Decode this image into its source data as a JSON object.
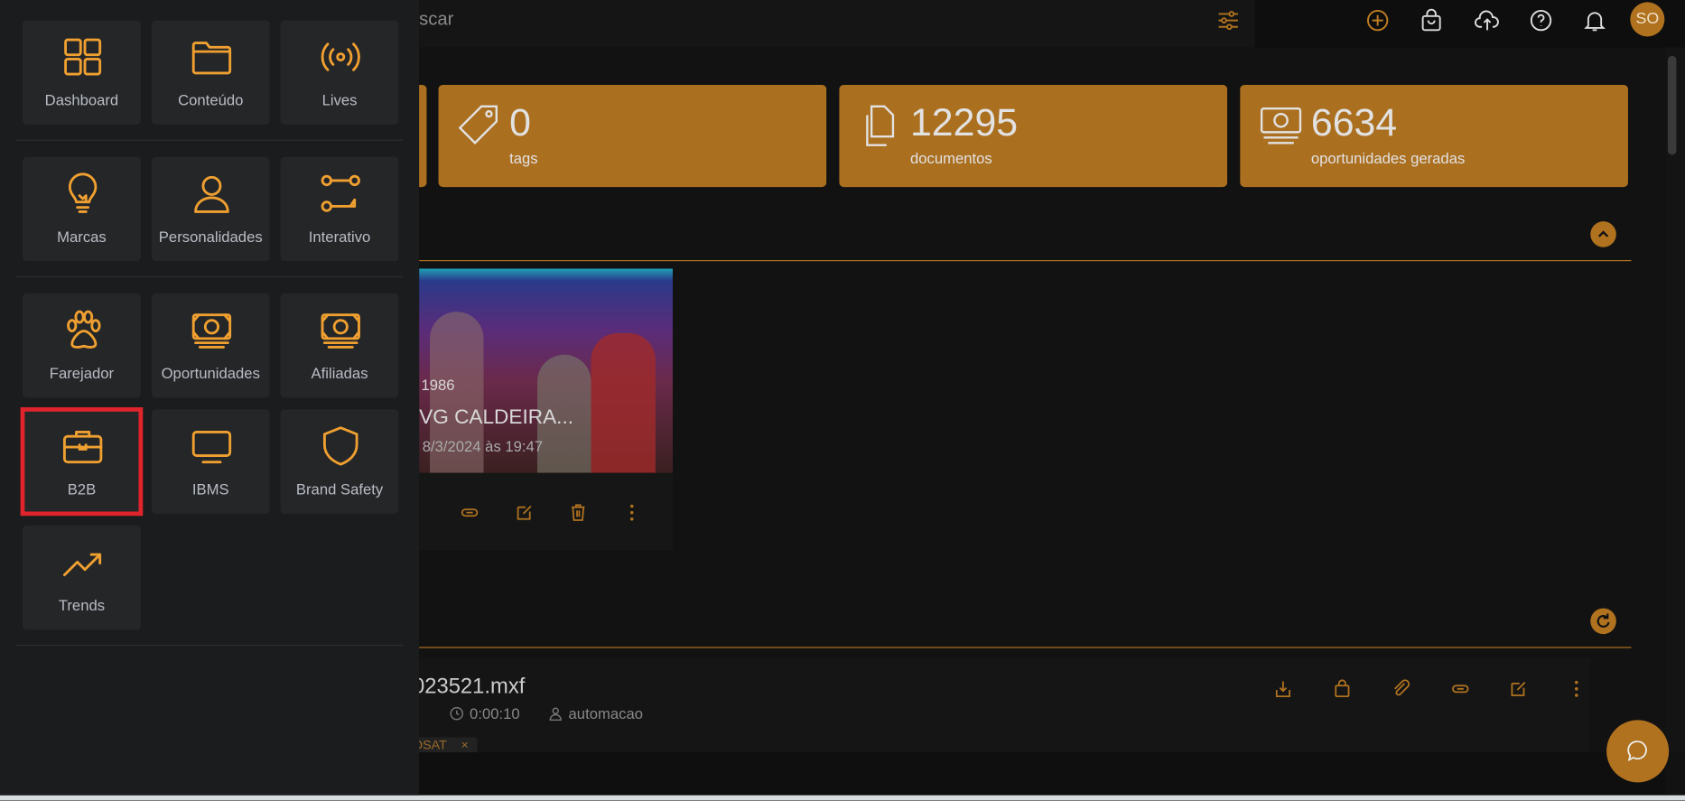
{
  "header": {
    "search_placeholder": "scar",
    "avatar_initials": "SO",
    "icons": [
      "filter-sliders-icon",
      "plus-circle-icon",
      "shopping-bag-icon",
      "cloud-upload-icon",
      "help-icon",
      "bell-icon"
    ]
  },
  "stats": [
    {
      "value": "0",
      "label": "tags",
      "icon": "tag-icon"
    },
    {
      "value": "12295",
      "label": "documentos",
      "icon": "documents-icon"
    },
    {
      "value": "6634",
      "label": "oportunidades geradas",
      "icon": "money-icon"
    }
  ],
  "video": {
    "year": "1986",
    "title": "VG CALDEIRA...",
    "date": "8/3/2024 às 19:47"
  },
  "file": {
    "name": "023521.mxf",
    "duration": "0:00:10",
    "user": "automacao",
    "tag": "OSAT",
    "tag_remove": "×"
  },
  "menu": {
    "highlighted": "B2B",
    "accent": "#f0a030",
    "items": [
      {
        "label": "Dashboard",
        "icon": "grid"
      },
      {
        "label": "Conteúdo",
        "icon": "folder"
      },
      {
        "label": "Lives",
        "icon": "broadcast"
      },
      {
        "label": "Marcas",
        "icon": "bulb"
      },
      {
        "label": "Personalidades",
        "icon": "user"
      },
      {
        "label": "Interativo",
        "icon": "flow"
      },
      {
        "label": "Farejador",
        "icon": "paw"
      },
      {
        "label": "Oportunidades",
        "icon": "money"
      },
      {
        "label": "Afiliadas",
        "icon": "money"
      },
      {
        "label": "B2B",
        "icon": "briefcase"
      },
      {
        "label": "IBMS",
        "icon": "monitor"
      },
      {
        "label": "Brand Safety",
        "icon": "shield"
      },
      {
        "label": "Trends",
        "icon": "trend"
      }
    ]
  }
}
